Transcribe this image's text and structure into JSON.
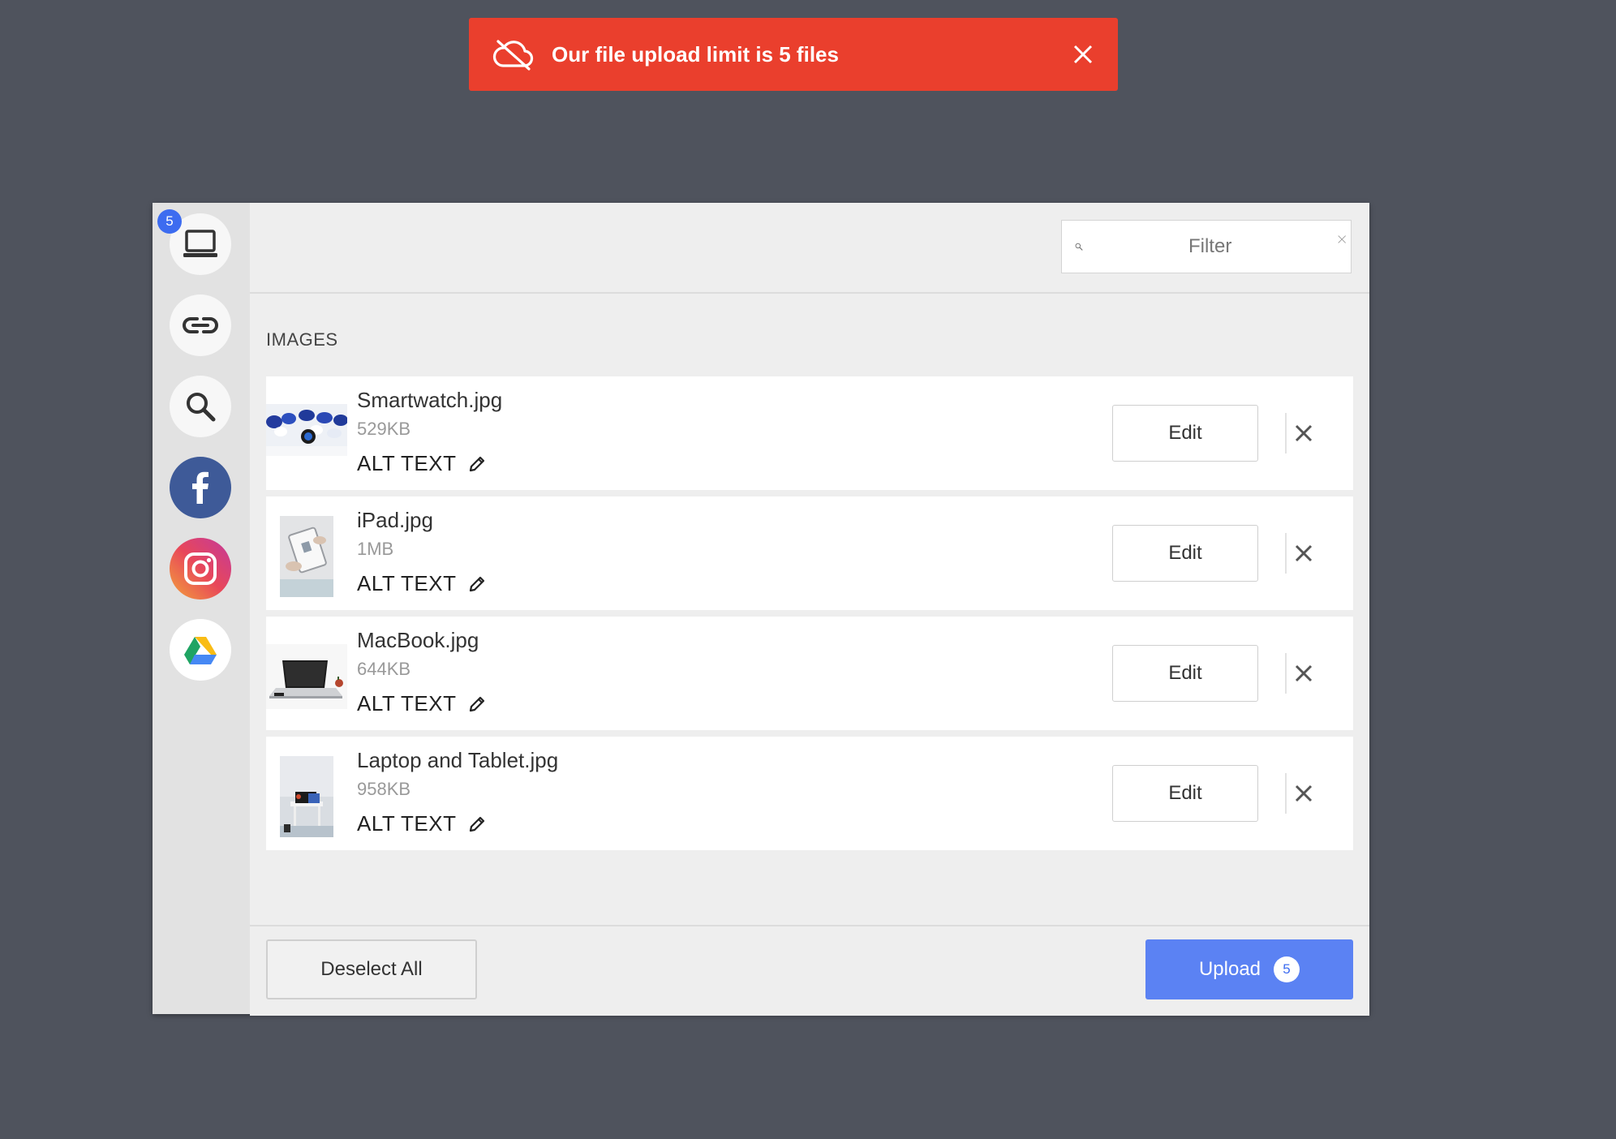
{
  "toast": {
    "message": "Our file upload limit is 5 files",
    "icon": "cloud-off-icon",
    "close_icon": "close-icon",
    "color": "#ea3f2d"
  },
  "sources": {
    "badge_count": "5",
    "items": [
      {
        "name": "my-device",
        "icon": "laptop-icon"
      },
      {
        "name": "link",
        "icon": "link-icon"
      },
      {
        "name": "image-search",
        "icon": "search-icon"
      },
      {
        "name": "facebook",
        "icon": "facebook-icon"
      },
      {
        "name": "instagram",
        "icon": "instagram-icon"
      },
      {
        "name": "google-drive",
        "icon": "google-drive-icon"
      }
    ]
  },
  "filter": {
    "placeholder": "Filter",
    "value": ""
  },
  "section_title": "IMAGES",
  "files": [
    {
      "name": "Smartwatch.jpg",
      "size": "529KB",
      "alt_label": "ALT TEXT",
      "edit_label": "Edit"
    },
    {
      "name": "iPad.jpg",
      "size": "1MB",
      "alt_label": "ALT TEXT",
      "edit_label": "Edit"
    },
    {
      "name": "MacBook.jpg",
      "size": "644KB",
      "alt_label": "ALT TEXT",
      "edit_label": "Edit"
    },
    {
      "name": "Laptop and Tablet.jpg",
      "size": "958KB",
      "alt_label": "ALT TEXT",
      "edit_label": "Edit"
    }
  ],
  "footer": {
    "deselect_label": "Deselect All",
    "upload_label": "Upload",
    "upload_count": "5",
    "upload_color": "#5b82f3"
  }
}
